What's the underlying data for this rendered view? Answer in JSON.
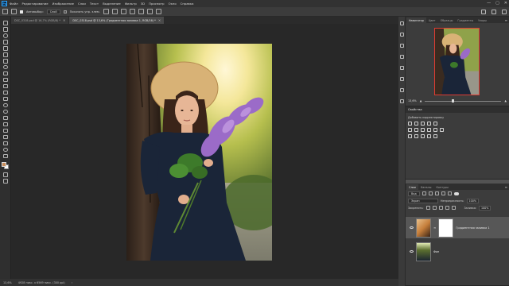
{
  "app": {
    "logo_text": "Ps"
  },
  "menu": [
    "Файл",
    "Редактирование",
    "Изображение",
    "Слои",
    "Текст",
    "Выделение",
    "Фильтр",
    "3D",
    "Просмотр",
    "Окно",
    "Справка"
  ],
  "window_controls": {
    "minimize": "—",
    "maximize": "▢",
    "close": "✕"
  },
  "options_bar": {
    "autoselect_label": "Автовыбор:",
    "autoselect_value": "Слой",
    "show_controls_label": "Показать упр. элем."
  },
  "tabs": [
    {
      "label": "DSC_0318.psd @ 16,7% (RGB/8) *",
      "active": false,
      "close": "×"
    },
    {
      "label": "DSC_0318.psd @ 13,6% (Градиентная заливка 1, RGB/16) *",
      "active": true,
      "close": "×"
    }
  ],
  "status": {
    "zoom": "13,6%",
    "doc_size": "4928 пикс. x 6569 пикс. (300 ppi)",
    "arrow": "›"
  },
  "navigator": {
    "tabs": [
      "Навигатор",
      "Цвет",
      "Образцы",
      "Градиенты",
      "Узоры"
    ],
    "zoom": "13,6%",
    "zoom_level": 0.35
  },
  "properties": {
    "title": "Свойства",
    "subtitle": "Добавить корректировку"
  },
  "layers": {
    "tabs": [
      "Слои",
      "Каналы",
      "Контуры"
    ],
    "filter_value": "Вид",
    "blend_mode": "Экран",
    "opacity_label": "Непрозрачность:",
    "opacity_value": "100%",
    "lock_label": "Закрепить:",
    "fill_label": "Заливка:",
    "fill_value": "100%",
    "items": [
      {
        "name": "Градиентная заливка 1",
        "selected": true
      },
      {
        "name": "Фон",
        "selected": false
      }
    ]
  },
  "colors": {
    "foreground": "#c98d5a",
    "background": "#ffffff",
    "accent": "#31a8ff",
    "nav_frame": "#e03c31"
  }
}
